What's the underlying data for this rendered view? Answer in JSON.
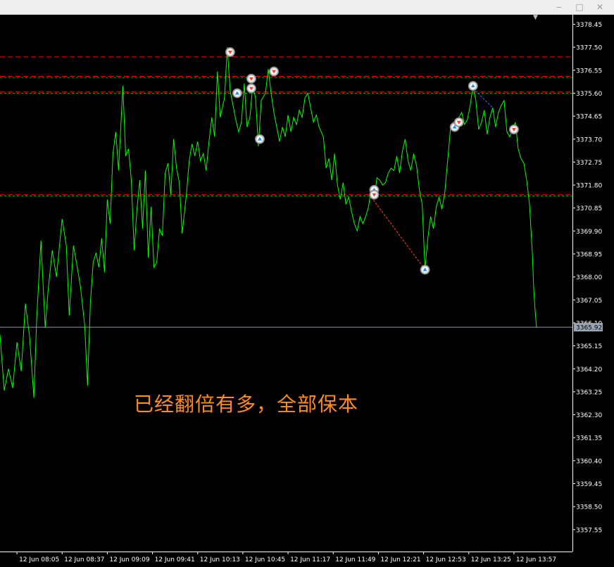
{
  "window": {
    "minimize": "‒",
    "maximize": "□",
    "close": "✕",
    "scroll_marker": "▼"
  },
  "annotation": "已经翻倍有多，全部保本",
  "current_price_label": "3365.92",
  "colors": {
    "background": "#000000",
    "price_line": "#00ff00",
    "axis": "#ffffff",
    "level_red": "#ff0000",
    "level_green": "#00a000",
    "annotation": "#ff8c1a",
    "sell_marker": "#ff3b30",
    "buy_marker": "#1e90ff",
    "current_price_bg": "#9aa7b8"
  },
  "chart_data": {
    "type": "line",
    "ylim": [
      3356.65,
      3379.0
    ],
    "xlim": [
      0,
      380
    ],
    "y_ticks": [
      "3378.45",
      "3377.50",
      "3376.55",
      "3375.60",
      "3374.65",
      "3373.70",
      "3372.75",
      "3371.80",
      "3370.85",
      "3369.90",
      "3368.95",
      "3368.00",
      "3367.05",
      "3366.10",
      "3365.15",
      "3364.20",
      "3363.25",
      "3362.30",
      "3361.35",
      "3360.40",
      "3359.45",
      "3358.50",
      "3357.55"
    ],
    "x_ticks": [
      {
        "label": "12 Jun 08:05",
        "x": 12
      },
      {
        "label": "12 Jun 08:37",
        "x": 44
      },
      {
        "label": "12 Jun 09:09",
        "x": 76
      },
      {
        "label": "12 Jun 09:41",
        "x": 108
      },
      {
        "label": "12 Jun 10:13",
        "x": 140
      },
      {
        "label": "12 Jun 10:45",
        "x": 172
      },
      {
        "label": "12 Jun 11:17",
        "x": 204
      },
      {
        "label": "12 Jun 11:49",
        "x": 236
      },
      {
        "label": "12 Jun 12:21",
        "x": 268
      },
      {
        "label": "12 Jun 12:53",
        "x": 300
      },
      {
        "label": "12 Jun 13:25",
        "x": 332
      },
      {
        "label": "12 Jun 13:57",
        "x": 364
      }
    ],
    "series": [
      {
        "values": [
          [
            0,
            3365.6
          ],
          [
            3,
            3363.3
          ],
          [
            6,
            3364.2
          ],
          [
            9,
            3363.4
          ],
          [
            12,
            3365.3
          ],
          [
            15,
            3364.1
          ],
          [
            18,
            3366.9
          ],
          [
            21,
            3365.5
          ],
          [
            24,
            3363.0
          ],
          [
            26,
            3366.3
          ],
          [
            29,
            3369.5
          ],
          [
            32,
            3365.9
          ],
          [
            34,
            3367.4
          ],
          [
            37,
            3369.1
          ],
          [
            40,
            3368.0
          ],
          [
            44,
            3370.4
          ],
          [
            47,
            3369.3
          ],
          [
            49,
            3366.4
          ],
          [
            52,
            3369.3
          ],
          [
            55,
            3368.3
          ],
          [
            57,
            3367.6
          ],
          [
            60,
            3366.0
          ],
          [
            62,
            3363.5
          ],
          [
            64,
            3366.9
          ],
          [
            66,
            3368.6
          ],
          [
            68,
            3369.0
          ],
          [
            70,
            3368.4
          ],
          [
            72,
            3369.6
          ],
          [
            74,
            3368.2
          ],
          [
            76,
            3371.2
          ],
          [
            78,
            3370.2
          ],
          [
            80,
            3373.1
          ],
          [
            82,
            3374.0
          ],
          [
            84,
            3372.4
          ],
          [
            87,
            3375.9
          ],
          [
            89,
            3373.0
          ],
          [
            91,
            3373.3
          ],
          [
            93,
            3372.0
          ],
          [
            95,
            3369.1
          ],
          [
            97,
            3370.8
          ],
          [
            99,
            3372.0
          ],
          [
            101,
            3370.0
          ],
          [
            103,
            3372.4
          ],
          [
            105,
            3368.8
          ],
          [
            107,
            3370.9
          ],
          [
            109,
            3368.4
          ],
          [
            111,
            3368.6
          ],
          [
            113,
            3370.0
          ],
          [
            115,
            3369.7
          ],
          [
            117,
            3372.3
          ],
          [
            119,
            3372.7
          ],
          [
            121,
            3371.4
          ],
          [
            123,
            3373.7
          ],
          [
            125,
            3372.5
          ],
          [
            127,
            3371.9
          ],
          [
            129,
            3369.8
          ],
          [
            132,
            3371.4
          ],
          [
            134,
            3372.8
          ],
          [
            136,
            3373.5
          ],
          [
            138,
            3373.0
          ],
          [
            140,
            3373.6
          ],
          [
            142,
            3372.8
          ],
          [
            144,
            3373.1
          ],
          [
            146,
            3372.4
          ],
          [
            148,
            3373.6
          ],
          [
            150,
            3374.6
          ],
          [
            152,
            3373.8
          ],
          [
            154,
            3376.5
          ],
          [
            156,
            3374.6
          ],
          [
            159,
            3375.4
          ],
          [
            161,
            3377.5
          ],
          [
            163,
            3375.7
          ],
          [
            165,
            3375.1
          ],
          [
            167,
            3374.5
          ],
          [
            169,
            3374.0
          ],
          [
            171,
            3374.4
          ],
          [
            173,
            3376.0
          ],
          [
            175,
            3374.2
          ],
          [
            177,
            3374.6
          ],
          [
            179,
            3375.9
          ],
          [
            181,
            3375.4
          ],
          [
            183,
            3373.4
          ],
          [
            185,
            3375.3
          ],
          [
            188,
            3375.6
          ],
          [
            190,
            3376.6
          ],
          [
            192,
            3375.6
          ],
          [
            194,
            3374.8
          ],
          [
            196,
            3374.2
          ],
          [
            198,
            3373.6
          ],
          [
            200,
            3374.2
          ],
          [
            202,
            3373.8
          ],
          [
            204,
            3374.7
          ],
          [
            206,
            3374.0
          ],
          [
            208,
            3374.6
          ],
          [
            210,
            3374.3
          ],
          [
            212,
            3374.9
          ],
          [
            214,
            3374.6
          ],
          [
            216,
            3375.4
          ],
          [
            218,
            3375.6
          ],
          [
            220,
            3375.0
          ],
          [
            222,
            3374.4
          ],
          [
            224,
            3374.7
          ],
          [
            226,
            3374.2
          ],
          [
            229,
            3373.8
          ],
          [
            231,
            3372.5
          ],
          [
            233,
            3372.9
          ],
          [
            235,
            3372.0
          ],
          [
            237,
            3373.1
          ],
          [
            239,
            3371.8
          ],
          [
            241,
            3371.2
          ],
          [
            243,
            3371.9
          ],
          [
            245,
            3371.0
          ],
          [
            247,
            3371.3
          ],
          [
            249,
            3370.7
          ],
          [
            251,
            3370.2
          ],
          [
            253,
            3369.9
          ],
          [
            255,
            3370.5
          ],
          [
            257,
            3370.2
          ],
          [
            259,
            3370.5
          ],
          [
            261,
            3370.9
          ],
          [
            263,
            3371.7
          ],
          [
            265,
            3371.3
          ],
          [
            267,
            3372.1
          ],
          [
            269,
            3372.0
          ],
          [
            271,
            3371.8
          ],
          [
            273,
            3371.9
          ],
          [
            275,
            3372.3
          ],
          [
            277,
            3372.5
          ],
          [
            279,
            3372.4
          ],
          [
            281,
            3373.0
          ],
          [
            283,
            3372.3
          ],
          [
            285,
            3373.2
          ],
          [
            287,
            3373.7
          ],
          [
            289,
            3372.8
          ],
          [
            291,
            3372.4
          ],
          [
            293,
            3373.1
          ],
          [
            295,
            3372.6
          ],
          [
            297,
            3371.6
          ],
          [
            299,
            3371.0
          ],
          [
            301,
            3368.3
          ],
          [
            303,
            3369.6
          ],
          [
            305,
            3370.5
          ],
          [
            307,
            3370.0
          ],
          [
            309,
            3370.9
          ],
          [
            311,
            3371.3
          ],
          [
            313,
            3370.8
          ],
          [
            315,
            3371.5
          ],
          [
            317,
            3372.8
          ],
          [
            319,
            3374.1
          ],
          [
            321,
            3374.4
          ],
          [
            323,
            3374.2
          ],
          [
            325,
            3374.6
          ],
          [
            327,
            3374.8
          ],
          [
            329,
            3374.3
          ],
          [
            331,
            3374.5
          ],
          [
            333,
            3375.1
          ],
          [
            335,
            3375.9
          ],
          [
            337,
            3375.3
          ],
          [
            339,
            3374.1
          ],
          [
            341,
            3374.4
          ],
          [
            343,
            3374.9
          ],
          [
            345,
            3373.9
          ],
          [
            347,
            3374.6
          ],
          [
            349,
            3375.0
          ],
          [
            351,
            3374.2
          ],
          [
            353,
            3374.8
          ],
          [
            355,
            3375.1
          ],
          [
            357,
            3375.3
          ],
          [
            359,
            3374.0
          ],
          [
            361,
            3373.8
          ],
          [
            363,
            3374.1
          ],
          [
            365,
            3374.4
          ],
          [
            367,
            3373.3
          ],
          [
            369,
            3372.9
          ],
          [
            371,
            3372.7
          ],
          [
            373,
            3372.0
          ],
          [
            375,
            3371.0
          ],
          [
            377,
            3369.0
          ],
          [
            378,
            3367.5
          ],
          [
            379,
            3366.6
          ],
          [
            380,
            3365.9
          ]
        ]
      }
    ],
    "levels": [
      {
        "value": 3377.1,
        "color": "#ff0000"
      },
      {
        "value": 3376.3,
        "color": "#ff0000"
      },
      {
        "value": 3376.25,
        "color": "#00a000"
      },
      {
        "value": 3375.65,
        "color": "#ff0000"
      },
      {
        "value": 3375.6,
        "color": "#00a000"
      },
      {
        "value": 3371.4,
        "color": "#ff0000"
      },
      {
        "value": 3371.35,
        "color": "#00a000"
      }
    ],
    "current_price": 3365.92,
    "trades": [
      {
        "from": [
          263,
          3371.3
        ],
        "to": [
          301,
          3368.3
        ],
        "color": "#ff4020"
      },
      {
        "from": [
          333,
          3375.9
        ],
        "to": [
          349,
          3375.0
        ],
        "color": "#3a6dff"
      }
    ],
    "markers": [
      {
        "x": 163,
        "y": 3377.3,
        "side": "sell"
      },
      {
        "x": 168,
        "y": 3375.6,
        "side": "buy"
      },
      {
        "x": 178,
        "y": 3376.2,
        "side": "sell"
      },
      {
        "x": 178,
        "y": 3375.8,
        "side": "sell"
      },
      {
        "x": 184,
        "y": 3373.7,
        "side": "buy"
      },
      {
        "x": 194,
        "y": 3376.5,
        "side": "sell"
      },
      {
        "x": 265,
        "y": 3371.6,
        "side": "buy"
      },
      {
        "x": 265,
        "y": 3371.4,
        "side": "sell"
      },
      {
        "x": 301,
        "y": 3368.3,
        "side": "buy"
      },
      {
        "x": 322,
        "y": 3374.2,
        "side": "buy"
      },
      {
        "x": 325,
        "y": 3374.4,
        "side": "sell"
      },
      {
        "x": 335,
        "y": 3375.9,
        "side": "buy"
      },
      {
        "x": 364,
        "y": 3374.1,
        "side": "sell"
      }
    ]
  }
}
